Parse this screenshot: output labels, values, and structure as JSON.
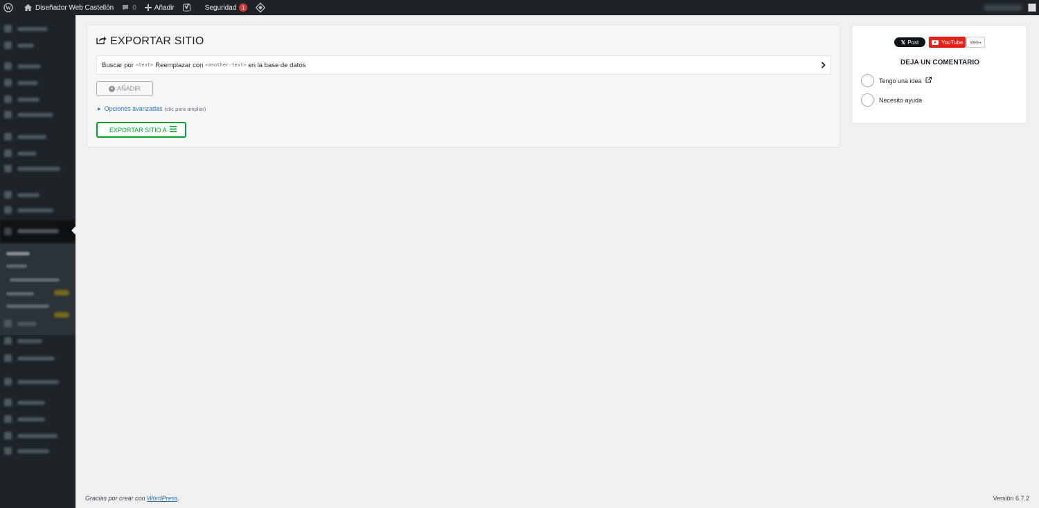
{
  "admin_bar": {
    "site_name": "Diseñador Web Castellón",
    "comments_count": "0",
    "new_label": "Añadir",
    "security_label": "Seguridad",
    "security_count": "1"
  },
  "main": {
    "title": "EXPORTAR SITIO",
    "search_prefix": "Buscar por",
    "search_code": "<text>",
    "replace_label": "Reemplazar con",
    "replace_code": "<another-text>",
    "search_suffix": "en la base de datos",
    "add_button": "AÑADIR",
    "advanced_link": "Opciones avanzadas",
    "advanced_hint": "(clic para ampliar)",
    "export_button": "EXPORTAR SITIO A"
  },
  "sidebar_card": {
    "x_post": "Post",
    "youtube": "YouTube",
    "youtube_count": "999+",
    "title": "DEJA UN COMENTARIO",
    "options": [
      "Tengo una idea",
      "Necesito ayuda"
    ]
  },
  "footer": {
    "thanks_prefix": "Gracias por crear con",
    "wordpress_link": "WordPress",
    "thanks_suffix": ".",
    "version": "Versión 6.7.2"
  }
}
